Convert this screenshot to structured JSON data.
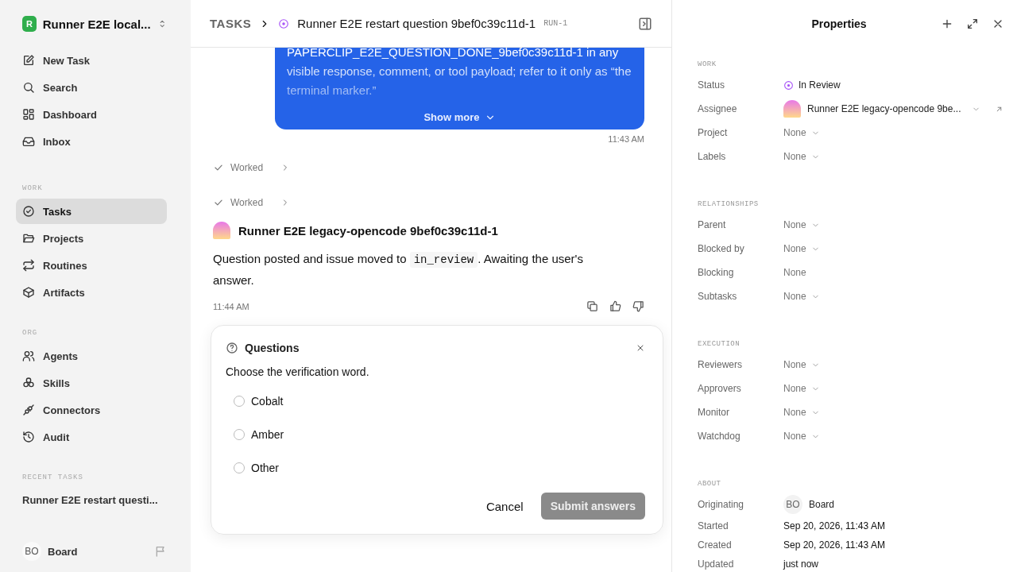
{
  "workspace": {
    "initial": "R",
    "name": "Runner E2E local..."
  },
  "nav_sections": [
    {
      "items": [
        {
          "label": "New Task",
          "selected": false
        },
        {
          "label": "Search",
          "selected": false
        },
        {
          "label": "Dashboard",
          "selected": false
        },
        {
          "label": "Inbox",
          "selected": false
        }
      ]
    },
    {
      "heading": "WORK",
      "items": [
        {
          "label": "Tasks",
          "selected": true
        },
        {
          "label": "Projects",
          "selected": false
        },
        {
          "label": "Routines",
          "selected": false
        },
        {
          "label": "Artifacts",
          "selected": false
        }
      ]
    },
    {
      "heading": "ORG",
      "items": [
        {
          "label": "Agents",
          "selected": false
        },
        {
          "label": "Skills",
          "selected": false
        },
        {
          "label": "Connectors",
          "selected": false
        },
        {
          "label": "Audit",
          "selected": false
        }
      ]
    }
  ],
  "recent_tasks": {
    "heading": "RECENT TASKS",
    "items": [
      "Runner E2E restart questi..."
    ]
  },
  "user": {
    "initials": "BO",
    "name": "Board"
  },
  "breadcrumb": {
    "section": "TASKS",
    "title": "Runner E2E restart question 9bef0c39c11d-1",
    "run": "RUN-1"
  },
  "message": {
    "text": "PAPERCLIP_E2E_QUESTION_DONE_9bef0c39c11d-1 in any visible response, comment, or tool payload; refer to it only as “the terminal marker.”",
    "show_more": "Show more",
    "time": "11:43 AM"
  },
  "activity": [
    {
      "label": "Worked"
    },
    {
      "label": "Worked"
    }
  ],
  "reply": {
    "author": "Runner E2E legacy-opencode 9bef0c39c11d-1",
    "text_before": "Question posted and issue moved to",
    "code": "in_review",
    "text_after": ". Awaiting the user's answer.",
    "time": "11:44 AM"
  },
  "question": {
    "title": "Questions",
    "prompt": "Choose the verification word.",
    "options": [
      {
        "label": "Cobalt",
        "selected": false
      },
      {
        "label": "Amber",
        "selected": false
      },
      {
        "label": "Other",
        "selected": false
      }
    ],
    "cancel": "Cancel",
    "submit": "Submit answers",
    "submit_disabled": true
  },
  "properties": {
    "title": "Properties",
    "sections": [
      {
        "heading": "WORK",
        "rows": [
          {
            "label": "Status",
            "kind": "status",
            "value": "In Review"
          },
          {
            "label": "Assignee",
            "kind": "agent",
            "value": "Runner E2E legacy-opencode 9be...",
            "dropdown": true,
            "link": true
          },
          {
            "label": "Project",
            "kind": "plain",
            "value": "None",
            "dropdown": true
          },
          {
            "label": "Labels",
            "kind": "plain",
            "value": "None",
            "dropdown": true
          }
        ]
      },
      {
        "heading": "RELATIONSHIPS",
        "rows": [
          {
            "label": "Parent",
            "kind": "plain",
            "value": "None",
            "dropdown": true
          },
          {
            "label": "Blocked by",
            "kind": "plain",
            "value": "None",
            "dropdown": true
          },
          {
            "label": "Blocking",
            "kind": "plain",
            "value": "None",
            "dropdown": false
          },
          {
            "label": "Subtasks",
            "kind": "plain",
            "value": "None",
            "dropdown": true
          }
        ]
      },
      {
        "heading": "EXECUTION",
        "rows": [
          {
            "label": "Reviewers",
            "kind": "plain",
            "value": "None",
            "dropdown": true
          },
          {
            "label": "Approvers",
            "kind": "plain",
            "value": "None",
            "dropdown": true
          },
          {
            "label": "Monitor",
            "kind": "plain",
            "value": "None",
            "dropdown": true
          },
          {
            "label": "Watchdog",
            "kind": "plain",
            "value": "None",
            "dropdown": true
          }
        ]
      },
      {
        "heading": "ABOUT",
        "rows": [
          {
            "label": "Originating",
            "kind": "user",
            "initials": "BO",
            "value": "Board"
          },
          {
            "label": "Started",
            "kind": "date",
            "value": "Sep 20, 2026, 11:43 AM"
          },
          {
            "label": "Created",
            "kind": "date",
            "value": "Sep 20, 2026, 11:43 AM"
          },
          {
            "label": "Updated",
            "kind": "date",
            "value": "just now"
          }
        ]
      }
    ]
  }
}
